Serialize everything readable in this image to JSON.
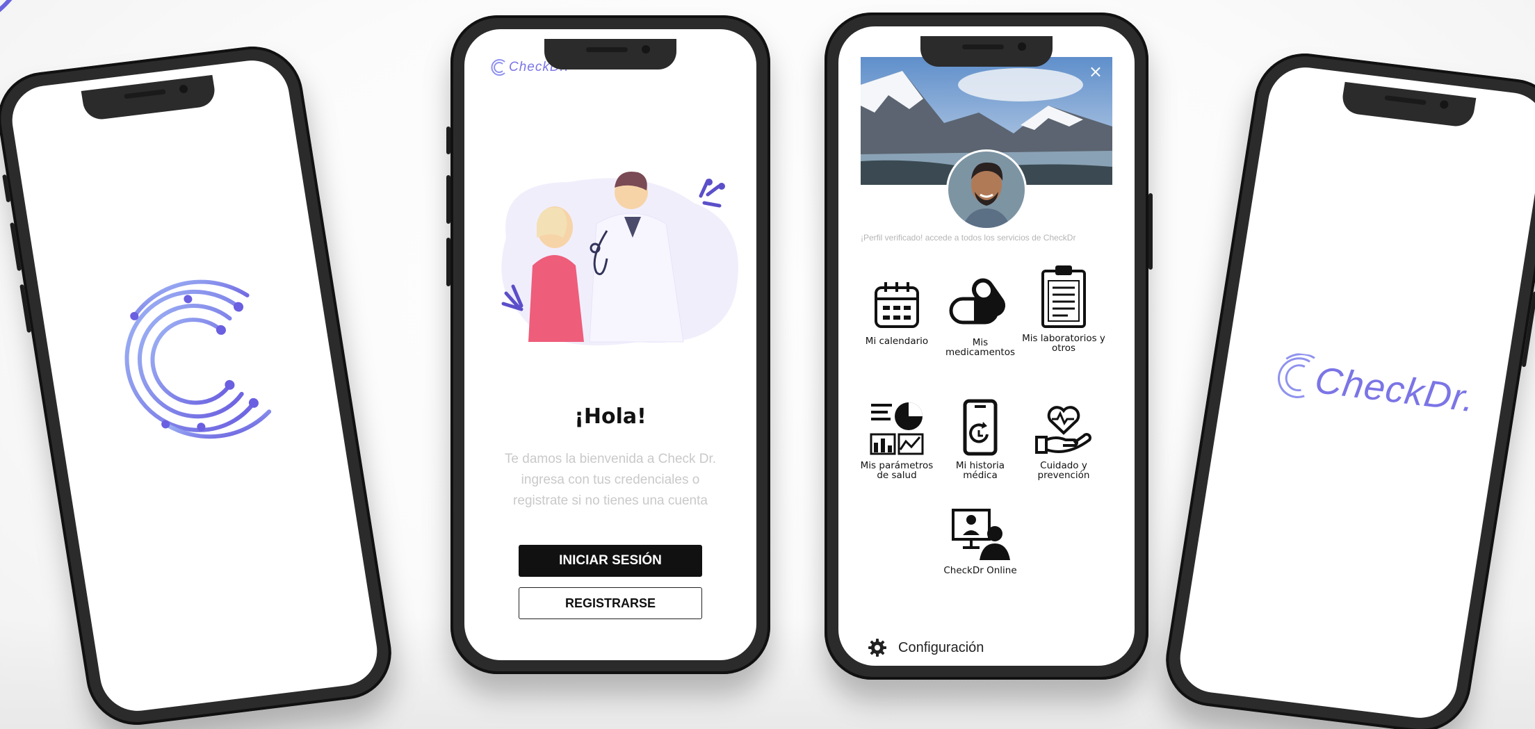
{
  "colors": {
    "brand": "#7b75e6",
    "brand_light": "#9fb6f5",
    "phone_frame": "#2b2b2b",
    "button_dark": "#111111"
  },
  "splash_left": {
    "logo_icon": "checkdr-c-logo-icon"
  },
  "login_screen": {
    "brand_name": "CheckDr.",
    "illustration": "doctor-patient-illustration",
    "greeting": "¡Hola!",
    "welcome_text": "Te damos la bienvenida a Check Dr. ingresa con tus credenciales o registrate si no tienes una cuenta",
    "login_button": "INICIAR SESIÓN",
    "register_button": "REGISTRARSE"
  },
  "profile_screen": {
    "close_label": "×",
    "cover_image": "mountain-landscape-photo",
    "avatar": "user-avatar-photo",
    "verified_text": "¡Perfil verificado! accede a todos los servicios de CheckDr",
    "services": [
      {
        "label": "Mi calendario",
        "icon": "calendar-icon"
      },
      {
        "label": "Mis medicamentos",
        "icon": "pill-icon"
      },
      {
        "label": "Mis laboratorios y otros",
        "icon": "clipboard-icon"
      },
      {
        "label": "Mis parámetros de salud",
        "icon": "charts-icon"
      },
      {
        "label": "Mi historia médica",
        "icon": "phone-history-icon"
      },
      {
        "label": "Cuidado y prevención",
        "icon": "heart-hand-icon"
      },
      {
        "label": "CheckDr Online",
        "icon": "video-consult-icon"
      }
    ],
    "settings_label": "Configuración",
    "settings_icon": "gear-icon"
  },
  "splash_right": {
    "brand_name": "CheckDr."
  }
}
